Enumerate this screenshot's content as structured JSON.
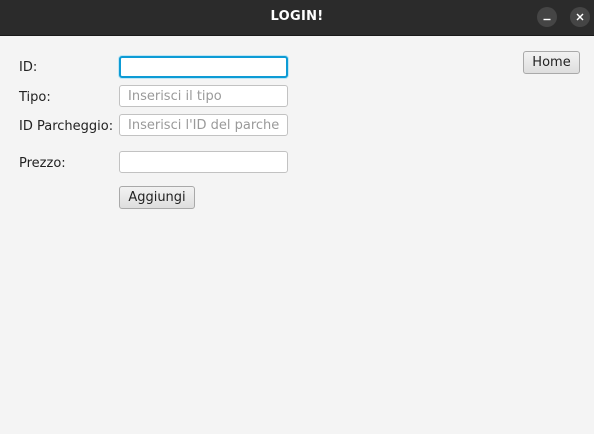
{
  "window": {
    "title": "LOGIN!",
    "minimize_icon": "minimize-icon",
    "close_icon": "close-icon"
  },
  "form": {
    "id_label": "ID:",
    "id_value": "",
    "tipo_label": "Tipo:",
    "tipo_placeholder": "Inserisci il tipo",
    "parcheggio_label": "ID Parcheggio:",
    "parcheggio_placeholder": "Inserisci l'ID del parcheggio",
    "prezzo_label": "Prezzo:",
    "prezzo_value": "",
    "add_button": "Aggiungi"
  },
  "nav": {
    "home_button": "Home"
  },
  "colors": {
    "titlebar": "#2b2b2b",
    "background": "#f4f4f4",
    "focus": "#0d9bd5"
  }
}
